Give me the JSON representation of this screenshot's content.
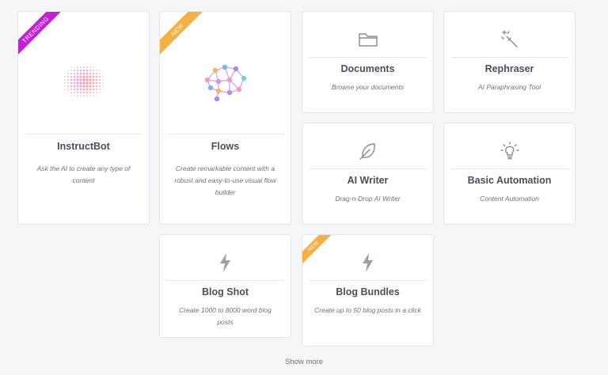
{
  "colors": {
    "trending_ribbon": "#c21fd6",
    "new_ribbon": "#f5b042",
    "icon_gray": "#8a8e98"
  },
  "cards": [
    {
      "title": "InstructBot",
      "description": "Ask the AI to create any type of content",
      "ribbon": "TRENDING",
      "icon": "dotted-brain-icon"
    },
    {
      "title": "Flows",
      "description": "Create remarkable content with a robust and easy-to-use visual flow builder",
      "ribbon": "NEW",
      "icon": "network-brain-icon"
    },
    {
      "title": "Documents",
      "description": "Browse your documents",
      "icon": "folder-icon"
    },
    {
      "title": "Rephraser",
      "description": "AI Paraphrasing Tool",
      "icon": "magic-wand-icon"
    },
    {
      "title": "AI Writer",
      "description": "Drag-n-Drop AI Writer",
      "icon": "feather-icon"
    },
    {
      "title": "Basic Automation",
      "description": "Content Automation",
      "icon": "lightbulb-icon"
    },
    {
      "title": "Blog Shot",
      "description": "Create 1000 to 8000 word blog posts",
      "icon": "lightning-icon"
    },
    {
      "title": "Blog Bundles",
      "description": "Create up to 50 blog posts in a click",
      "ribbon": "NEW",
      "icon": "lightning-icon"
    }
  ],
  "show_more_label": "Show more"
}
